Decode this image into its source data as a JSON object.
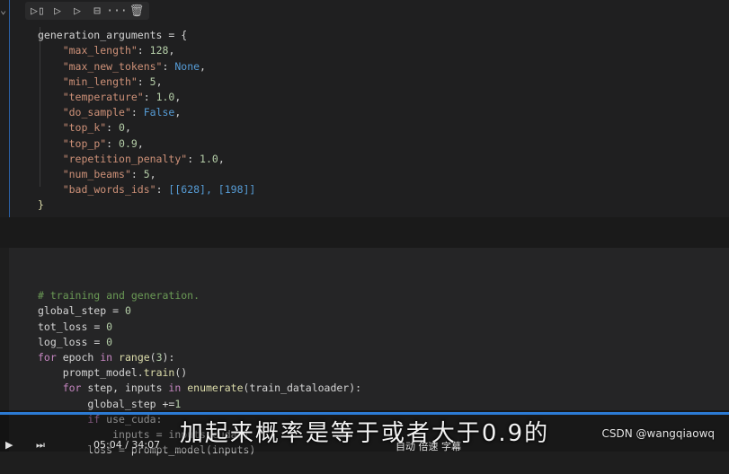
{
  "toolbar": {
    "icons": [
      "run-cell-icon",
      "run-above-icon",
      "run-below-icon",
      "split-cell-icon",
      "more-icon",
      "delete-icon"
    ],
    "glyphs": [
      "▷▯",
      "▷",
      "▷",
      "⊟",
      "···",
      "🗑"
    ]
  },
  "cell1": {
    "lines": [
      [
        "generation_arguments",
        " = {"
      ],
      [
        "\"max_length\"",
        ": ",
        "128",
        ","
      ],
      [
        "\"max_new_tokens\"",
        ": ",
        "None",
        ","
      ],
      [
        "\"min_length\"",
        ": ",
        "5",
        ","
      ],
      [
        "\"temperature\"",
        ": ",
        "1.0",
        ","
      ],
      [
        "\"do_sample\"",
        ": ",
        "False",
        ","
      ],
      [
        "\"top_k\"",
        ": ",
        "0",
        ","
      ],
      [
        "\"top_p\"",
        ": ",
        "0.9",
        ","
      ],
      [
        "\"repetition_penalty\"",
        ": ",
        "1.0",
        ","
      ],
      [
        "\"num_beams\"",
        ": ",
        "5",
        ","
      ],
      [
        "\"bad_words_ids\"",
        ": ",
        "[[628], [198]]",
        ""
      ],
      [
        "}"
      ]
    ]
  },
  "cell2": {
    "comment": "# training and generation.",
    "l1": [
      "global_step",
      " = ",
      "0"
    ],
    "l2": [
      "tot_loss",
      " = ",
      "0"
    ],
    "l3": [
      "log_loss",
      " = ",
      "0"
    ],
    "l4": [
      "for",
      " epoch ",
      "in",
      " ",
      "range",
      "(",
      "3",
      "):"
    ],
    "l5": [
      "prompt_model",
      ".",
      "train",
      "()"
    ],
    "l6": [
      "for",
      " step, inputs ",
      "in",
      " ",
      "enumerate",
      "(train_dataloader):"
    ],
    "l7": [
      "global_step",
      " +=",
      "1"
    ],
    "l8": [
      "if",
      " use_cuda:"
    ],
    "l9": [
      "inputs",
      " = ",
      "inputs.cuda()"
    ],
    "l10": [
      "loss",
      " = ",
      "prompt_model(inputs)"
    ]
  },
  "overlay": {
    "subtitle": "加起来概率是等于或者大于0.9的",
    "watermark": "CSDN @wangqiaowq",
    "time": "05:04 / 34:07",
    "controls_right": "自动  倍速  字幕"
  }
}
